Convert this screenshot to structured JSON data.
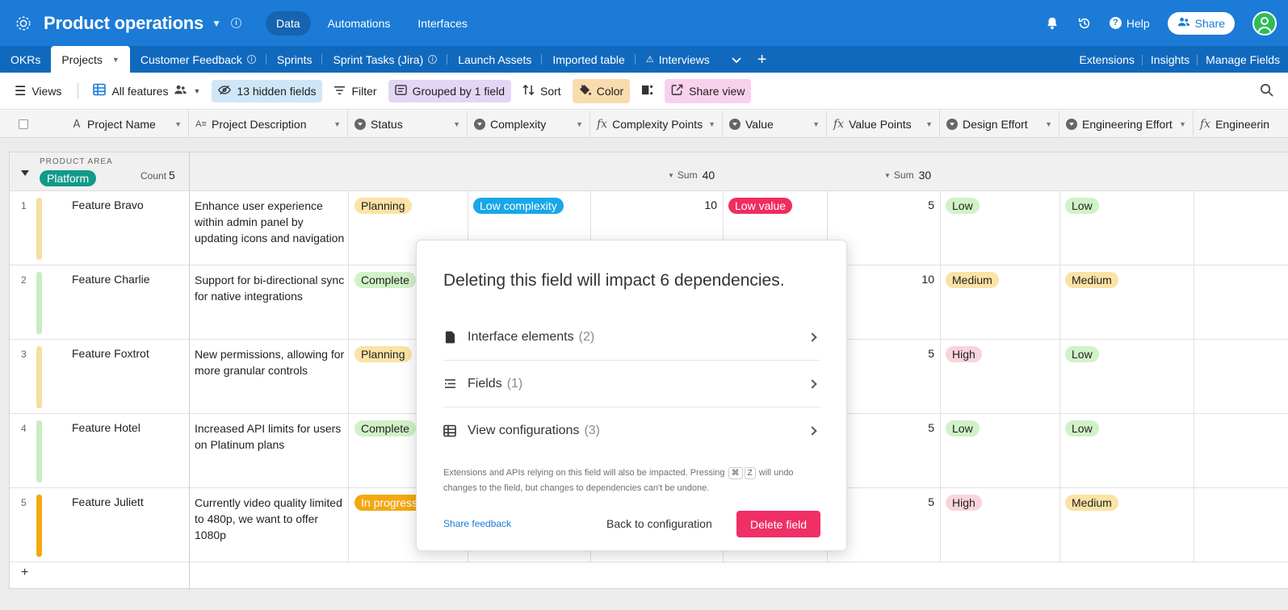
{
  "topbar": {
    "base_title": "Product operations",
    "nav": [
      "Data",
      "Automations",
      "Interfaces"
    ],
    "help_label": "Help",
    "share_label": "Share"
  },
  "tabs": {
    "items": [
      "OKRs",
      "Projects",
      "Customer Feedback",
      "Sprints",
      "Sprint Tasks (Jira)",
      "Launch Assets",
      "Imported table",
      "Interviews"
    ],
    "right": [
      "Extensions",
      "Insights",
      "Manage Fields"
    ]
  },
  "viewbar": {
    "views_label": "Views",
    "view_name": "All features",
    "hidden_fields": "13 hidden fields",
    "filter": "Filter",
    "grouped": "Grouped by 1 field",
    "sort": "Sort",
    "color": "Color",
    "share_view": "Share view"
  },
  "columns": [
    "Project Name",
    "Project Description",
    "Status",
    "Complexity",
    "Complexity Points",
    "Value",
    "Value Points",
    "Design Effort",
    "Engineering Effort",
    "Engineerin"
  ],
  "group": {
    "label": "PRODUCT AREA",
    "name": "Platform",
    "count_label": "Count",
    "count": "5",
    "sum_label": "Sum",
    "complexity_sum": "40",
    "value_sum": "30"
  },
  "rows": [
    {
      "num": "1",
      "name": "Feature Bravo",
      "desc": "Enhance user experience within admin panel by updating icons and navigation",
      "status": "Planning",
      "complexity": "Low complexity",
      "cpoints": "10",
      "value": "Low value",
      "vpoints": "5",
      "design": "Low",
      "eng": "Low",
      "bar": "#f6dfa0"
    },
    {
      "num": "2",
      "name": "Feature Charlie",
      "desc": "Support for bi-directional sync for native integrations",
      "status": "Complete",
      "complexity": "",
      "cpoints": "",
      "value": "",
      "vpoints": "10",
      "design": "Medium",
      "eng": "Medium",
      "bar": "#c9ecc2"
    },
    {
      "num": "3",
      "name": "Feature Foxtrot",
      "desc": "New permissions, allowing for more granular controls",
      "status": "Planning",
      "complexity": "",
      "cpoints": "",
      "value": "",
      "vpoints": "5",
      "design": "High",
      "eng": "Low",
      "bar": "#f6dfa0"
    },
    {
      "num": "4",
      "name": "Feature Hotel",
      "desc": "Increased API limits for users on Platinum plans",
      "status": "Complete",
      "complexity": "",
      "cpoints": "",
      "value": "",
      "vpoints": "5",
      "design": "Low",
      "eng": "Low",
      "bar": "#c9ecc2"
    },
    {
      "num": "5",
      "name": "Feature Juliett",
      "desc": "Currently video quality limited to 480p, we want to offer 1080p",
      "status": "In progress",
      "complexity": "",
      "cpoints": "",
      "value": "",
      "vpoints": "5",
      "design": "High",
      "eng": "Medium",
      "bar": "#f3a812"
    }
  ],
  "modal": {
    "title": "Deleting this field will impact 6 dependencies.",
    "items": [
      {
        "label": "Interface elements",
        "count": "(2)"
      },
      {
        "label": "Fields",
        "count": "(1)"
      },
      {
        "label": "View configurations",
        "count": "(3)"
      }
    ],
    "note_before": "Extensions and APIs relying on this field will also be impacted. Pressing",
    "key1": "⌘",
    "key2": "Z",
    "note_after": "will undo changes to the field, but changes to dependencies can't be undone.",
    "feedback": "Share feedback",
    "back": "Back to configuration",
    "delete": "Delete field"
  },
  "colors": {
    "topbar": "#1b7bd6",
    "tabbar": "#1169bd",
    "delete_button": "#ef2f66",
    "group_chip": "#119a8a"
  }
}
